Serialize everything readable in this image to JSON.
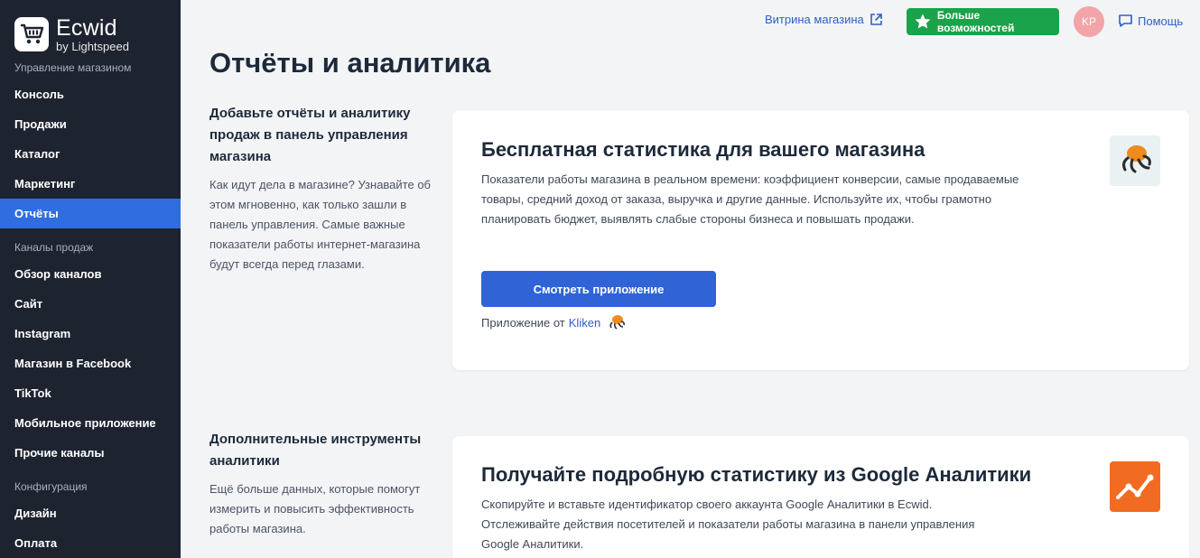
{
  "brand": {
    "name": "Ecwid",
    "sub": "by Lightspeed"
  },
  "sidebar": {
    "sections": [
      {
        "label": "Управление магазином",
        "items": [
          "Консоль",
          "Продажи",
          "Каталог",
          "Маркетинг",
          "Отчёты"
        ]
      },
      {
        "label": "Каналы продаж",
        "items": [
          "Обзор каналов",
          "Сайт",
          "Instagram",
          "Магазин в Facebook",
          "TikTok",
          "Мобильное приложение",
          "Прочие каналы"
        ]
      },
      {
        "label": "Конфигурация",
        "items": [
          "Дизайн",
          "Оплата"
        ]
      }
    ],
    "active": "Отчёты"
  },
  "header": {
    "storefront": "Витрина магазина",
    "more": "Больше возможностей",
    "avatar": "KP",
    "help": "Помощь"
  },
  "page": {
    "title": "Отчёты и аналитика"
  },
  "section1": {
    "title": "Добавьте отчёты и аналитику продаж в панель управления магазина",
    "desc": "Как идут дела в магазине? Узнавайте об этом мгновенно, как только зашли в панель управления. Самые важные показатели работы интернет-магазина будут всегда перед глазами."
  },
  "card1": {
    "title": "Бесплатная статистика для вашего магазина",
    "text": "Показатели работы магазина в реальном времени: коэффициент конверсии, самые продаваемые товары, средний доход от заказа, выручка и другие данные. Используйте их, чтобы грамотно планировать бюджет, выявлять слабые стороны бизнеса и повышать продажи.",
    "button": "Смотреть приложение",
    "by_label": "Приложение от",
    "by_link": "Kliken"
  },
  "section2": {
    "title": "Дополнительные инструменты аналитики",
    "desc": "Ещё больше данных, которые помогут измерить и повысить эффективность работы магазина."
  },
  "card2": {
    "title": "Получайте подробную статистику из Google Аналитики",
    "text": "Скопируйте и вставьте идентификатор своего аккаунта Google Аналитики в Ecwid. Отслеживайте действия посетителей и показатели работы магазина в панели управления Google Аналитики."
  },
  "colors": {
    "accent": "#2f63d6",
    "sidebar": "#1e2330",
    "green": "#1aa34a",
    "orange": "#f26b22"
  }
}
